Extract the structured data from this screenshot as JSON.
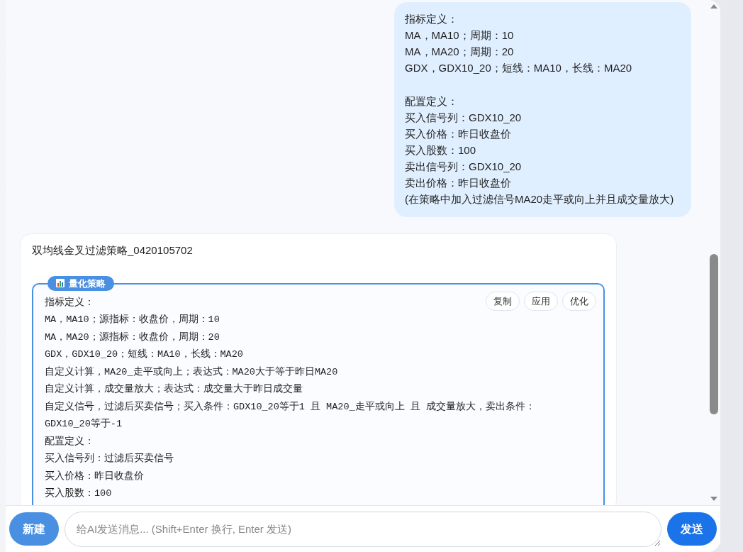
{
  "messages": [
    {
      "kind": "user",
      "paragraphs": [
        [
          "指标定义：",
          "MA，MA10；周期：10",
          "MA，MA20；周期：20",
          "GDX，GDX10_20；短线：MA10，长线：MA20"
        ],
        [
          "配置定义：",
          "买入信号列：GDX10_20",
          "买入价格：昨日收盘价",
          "买入股数：100",
          "卖出信号列：GDX10_20",
          "卖出价格：昨日收盘价",
          "(在策略中加入过滤信号MA20走平或向上并且成交量放大)"
        ]
      ]
    },
    {
      "kind": "assistant",
      "title": "双均线金叉过滤策略_0420105702",
      "strategy": {
        "label": "量化策略",
        "actions": [
          "复制",
          "应用",
          "优化"
        ],
        "lines": [
          "指标定义：",
          "MA，MA10；源指标：收盘价，周期：10",
          "MA，MA20；源指标：收盘价，周期：20",
          "GDX，GDX10_20；短线：MA10，长线：MA20",
          "自定义计算，MA20_走平或向上；表达式：MA20大于等于昨日MA20",
          "自定义计算，成交量放大；表达式：成交量大于昨日成交量",
          "自定义信号，过滤后买卖信号；买入条件：GDX10_20等于1 且 MA20_走平或向上 且 成交量放大，卖出条件：GDX10_20等于-1",
          "配置定义：",
          "买入信号列：过滤后买卖信号",
          "买入价格：昨日收盘价",
          "买入股数：100"
        ]
      }
    }
  ],
  "composer": {
    "new_button": "新建",
    "placeholder": "给AI发送消息... (Shift+Enter 换行, Enter 发送)",
    "send_button": "发送"
  }
}
